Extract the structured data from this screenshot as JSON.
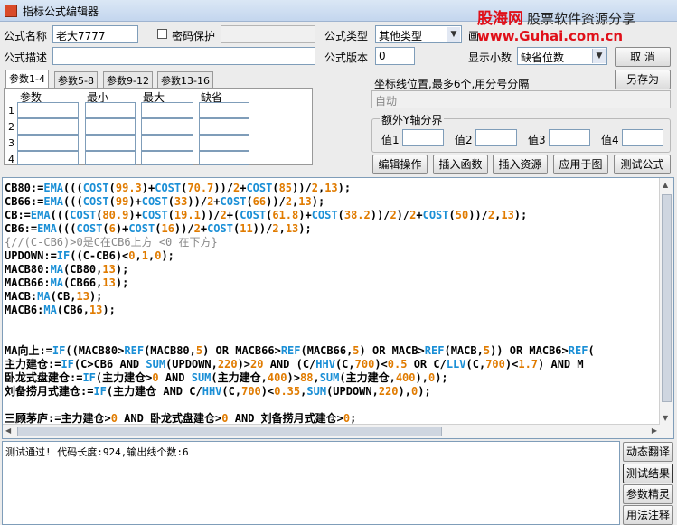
{
  "window": {
    "title": "指标公式编辑器"
  },
  "watermark": {
    "brand": "股海网",
    "slogan": "股票软件资源分享",
    "url": "www.Guhai.com.cn"
  },
  "form": {
    "name_label": "公式名称",
    "name_value": "老大7777",
    "password_label": "密码保护",
    "type_label": "公式类型",
    "type_value": "其他类型",
    "draw_label": "画",
    "desc_label": "公式描述",
    "version_label": "公式版本",
    "version_value": "0",
    "decimals_label": "显示小数",
    "decimals_value": "缺省位数"
  },
  "buttons": {
    "cancel": "取 消",
    "save_as": "另存为",
    "edit_op": "编辑操作",
    "insert_fn": "插入函数",
    "insert_res": "插入资源",
    "apply_chart": "应用于图",
    "test_formula": "测试公式",
    "dyn_translate": "动态翻译",
    "test_result": "测试结果",
    "param_tune": "参数精灵",
    "usage_note": "用法注释"
  },
  "tabs": [
    "参数1-4",
    "参数5-8",
    "参数9-12",
    "参数13-16"
  ],
  "params": {
    "headers": [
      "参数",
      "最小",
      "最大",
      "缺省"
    ],
    "rows": [
      "1",
      "2",
      "3",
      "4"
    ]
  },
  "axis": {
    "label": "坐标线位置,最多6个,用分号分隔",
    "value": "自动"
  },
  "yaxis": {
    "title": "额外Y轴分界",
    "labels": [
      "值1",
      "值2",
      "值3",
      "值4"
    ]
  },
  "code_lines": [
    [
      [
        "t",
        "CB80:="
      ],
      [
        "f",
        "EMA"
      ],
      [
        "t",
        "((("
      ],
      [
        "f",
        "COST"
      ],
      [
        "t",
        "("
      ],
      [
        "n",
        "99.3"
      ],
      [
        "t",
        ")+"
      ],
      [
        "f",
        "COST"
      ],
      [
        "t",
        "("
      ],
      [
        "n",
        "70.7"
      ],
      [
        "t",
        "))/"
      ],
      [
        "n",
        "2"
      ],
      [
        "t",
        "+"
      ],
      [
        "f",
        "COST"
      ],
      [
        "t",
        "("
      ],
      [
        "n",
        "85"
      ],
      [
        "t",
        "))/"
      ],
      [
        "n",
        "2"
      ],
      [
        "t",
        ","
      ],
      [
        "n",
        "13"
      ],
      [
        "t",
        ");"
      ]
    ],
    [
      [
        "t",
        "CB66:="
      ],
      [
        "f",
        "EMA"
      ],
      [
        "t",
        "((("
      ],
      [
        "f",
        "COST"
      ],
      [
        "t",
        "("
      ],
      [
        "n",
        "99"
      ],
      [
        "t",
        ")+"
      ],
      [
        "f",
        "COST"
      ],
      [
        "t",
        "("
      ],
      [
        "n",
        "33"
      ],
      [
        "t",
        "))/"
      ],
      [
        "n",
        "2"
      ],
      [
        "t",
        "+"
      ],
      [
        "f",
        "COST"
      ],
      [
        "t",
        "("
      ],
      [
        "n",
        "66"
      ],
      [
        "t",
        "))/"
      ],
      [
        "n",
        "2"
      ],
      [
        "t",
        ","
      ],
      [
        "n",
        "13"
      ],
      [
        "t",
        ");"
      ]
    ],
    [
      [
        "t",
        "CB:="
      ],
      [
        "f",
        "EMA"
      ],
      [
        "t",
        "((("
      ],
      [
        "f",
        "COST"
      ],
      [
        "t",
        "("
      ],
      [
        "n",
        "80.9"
      ],
      [
        "t",
        ")+"
      ],
      [
        "f",
        "COST"
      ],
      [
        "t",
        "("
      ],
      [
        "n",
        "19.1"
      ],
      [
        "t",
        "))/"
      ],
      [
        "n",
        "2"
      ],
      [
        "t",
        "+("
      ],
      [
        "f",
        "COST"
      ],
      [
        "t",
        "("
      ],
      [
        "n",
        "61.8"
      ],
      [
        "t",
        ")+"
      ],
      [
        "f",
        "COST"
      ],
      [
        "t",
        "("
      ],
      [
        "n",
        "38.2"
      ],
      [
        "t",
        "))/"
      ],
      [
        "n",
        "2"
      ],
      [
        "t",
        ")/"
      ],
      [
        "n",
        "2"
      ],
      [
        "t",
        "+"
      ],
      [
        "f",
        "COST"
      ],
      [
        "t",
        "("
      ],
      [
        "n",
        "50"
      ],
      [
        "t",
        "))/"
      ],
      [
        "n",
        "2"
      ],
      [
        "t",
        ","
      ],
      [
        "n",
        "13"
      ],
      [
        "t",
        ");"
      ]
    ],
    [
      [
        "t",
        "CB6:="
      ],
      [
        "f",
        "EMA"
      ],
      [
        "t",
        "((("
      ],
      [
        "f",
        "COST"
      ],
      [
        "t",
        "("
      ],
      [
        "n",
        "6"
      ],
      [
        "t",
        ")+"
      ],
      [
        "f",
        "COST"
      ],
      [
        "t",
        "("
      ],
      [
        "n",
        "16"
      ],
      [
        "t",
        "))/"
      ],
      [
        "n",
        "2"
      ],
      [
        "t",
        "+"
      ],
      [
        "f",
        "COST"
      ],
      [
        "t",
        "("
      ],
      [
        "n",
        "11"
      ],
      [
        "t",
        "))/"
      ],
      [
        "n",
        "2"
      ],
      [
        "t",
        ","
      ],
      [
        "n",
        "13"
      ],
      [
        "t",
        ");"
      ]
    ],
    [
      [
        "c",
        "{//(C-CB6)>0是C在CB6上方 <0 在下方}"
      ]
    ],
    [
      [
        "t",
        "UPDOWN:="
      ],
      [
        "f",
        "IF"
      ],
      [
        "t",
        "((C-CB6)<"
      ],
      [
        "n",
        "0"
      ],
      [
        "t",
        ","
      ],
      [
        "n",
        "1"
      ],
      [
        "t",
        ","
      ],
      [
        "n",
        "0"
      ],
      [
        "t",
        ");"
      ]
    ],
    [
      [
        "t",
        "MACB80:"
      ],
      [
        "f",
        "MA"
      ],
      [
        "t",
        "(CB80,"
      ],
      [
        "n",
        "13"
      ],
      [
        "t",
        ");"
      ]
    ],
    [
      [
        "t",
        "MACB66:"
      ],
      [
        "f",
        "MA"
      ],
      [
        "t",
        "(CB66,"
      ],
      [
        "n",
        "13"
      ],
      [
        "t",
        ");"
      ]
    ],
    [
      [
        "t",
        "MACB:"
      ],
      [
        "f",
        "MA"
      ],
      [
        "t",
        "(CB,"
      ],
      [
        "n",
        "13"
      ],
      [
        "t",
        ");"
      ]
    ],
    [
      [
        "t",
        "MACB6:"
      ],
      [
        "f",
        "MA"
      ],
      [
        "t",
        "(CB6,"
      ],
      [
        "n",
        "13"
      ],
      [
        "t",
        ");"
      ]
    ],
    [],
    [],
    [
      [
        "t",
        "MA向上:="
      ],
      [
        "f",
        "IF"
      ],
      [
        "t",
        "((MACB80>"
      ],
      [
        "f",
        "REF"
      ],
      [
        "t",
        "(MACB80,"
      ],
      [
        "n",
        "5"
      ],
      [
        "t",
        ") OR MACB66>"
      ],
      [
        "f",
        "REF"
      ],
      [
        "t",
        "(MACB66,"
      ],
      [
        "n",
        "5"
      ],
      [
        "t",
        ") OR MACB>"
      ],
      [
        "f",
        "REF"
      ],
      [
        "t",
        "(MACB,"
      ],
      [
        "n",
        "5"
      ],
      [
        "t",
        ")) OR MACB6>"
      ],
      [
        "f",
        "REF"
      ],
      [
        "t",
        "("
      ]
    ],
    [
      [
        "t",
        "主力建仓:="
      ],
      [
        "f",
        "IF"
      ],
      [
        "t",
        "(C>CB6 AND "
      ],
      [
        "f",
        "SUM"
      ],
      [
        "t",
        "(UPDOWN,"
      ],
      [
        "n",
        "220"
      ],
      [
        "t",
        ")>"
      ],
      [
        "n",
        "20"
      ],
      [
        "t",
        " AND (C/"
      ],
      [
        "f",
        "HHV"
      ],
      [
        "t",
        "(C,"
      ],
      [
        "n",
        "700"
      ],
      [
        "t",
        ")<"
      ],
      [
        "n",
        "0.5"
      ],
      [
        "t",
        " OR C/"
      ],
      [
        "f",
        "LLV"
      ],
      [
        "t",
        "(C,"
      ],
      [
        "n",
        "700"
      ],
      [
        "t",
        ")<"
      ],
      [
        "n",
        "1.7"
      ],
      [
        "t",
        ") AND M"
      ]
    ],
    [
      [
        "t",
        "卧龙式盘建仓:="
      ],
      [
        "f",
        "IF"
      ],
      [
        "t",
        "(主力建仓>"
      ],
      [
        "n",
        "0"
      ],
      [
        "t",
        " AND "
      ],
      [
        "f",
        "SUM"
      ],
      [
        "t",
        "(主力建仓,"
      ],
      [
        "n",
        "400"
      ],
      [
        "t",
        ")>"
      ],
      [
        "n",
        "88"
      ],
      [
        "t",
        ","
      ],
      [
        "f",
        "SUM"
      ],
      [
        "t",
        "(主力建仓,"
      ],
      [
        "n",
        "400"
      ],
      [
        "t",
        "),"
      ],
      [
        "n",
        "0"
      ],
      [
        "t",
        ");"
      ]
    ],
    [
      [
        "t",
        "刘备捞月式建仓:="
      ],
      [
        "f",
        "IF"
      ],
      [
        "t",
        "(主力建仓 AND C/"
      ],
      [
        "f",
        "HHV"
      ],
      [
        "t",
        "(C,"
      ],
      [
        "n",
        "700"
      ],
      [
        "t",
        ")<"
      ],
      [
        "n",
        "0.35"
      ],
      [
        "t",
        ","
      ],
      [
        "f",
        "SUM"
      ],
      [
        "t",
        "(UPDOWN,"
      ],
      [
        "n",
        "220"
      ],
      [
        "t",
        "),"
      ],
      [
        "n",
        "0"
      ],
      [
        "t",
        ");"
      ]
    ],
    [],
    [
      [
        "t",
        "三顾茅庐:=主力建仓>"
      ],
      [
        "n",
        "0"
      ],
      [
        "t",
        " AND 卧龙式盘建仓>"
      ],
      [
        "n",
        "0"
      ],
      [
        "t",
        " AND 刘备捞月式建仓>"
      ],
      [
        "n",
        "0"
      ],
      [
        "t",
        ";"
      ]
    ]
  ],
  "output": {
    "text": "测试通过! 代码长度:924,输出线个数:6"
  },
  "colors": {
    "function": "#1a8fd6",
    "number": "#e07b00",
    "comment": "#888888",
    "brand_red": "#e0101a"
  }
}
